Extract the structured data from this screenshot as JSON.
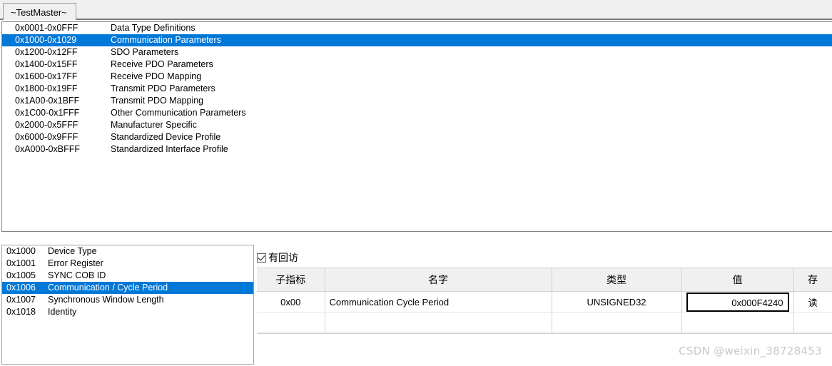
{
  "window": {
    "tab_label": "~TestMaster~"
  },
  "object_dictionary_ranges": {
    "selected_index": 1,
    "rows": [
      {
        "code": "0x0001-0x0FFF",
        "desc": "Data Type Definitions"
      },
      {
        "code": "0x1000-0x1029",
        "desc": "Communication Parameters"
      },
      {
        "code": "0x1200-0x12FF",
        "desc": "SDO Parameters"
      },
      {
        "code": "0x1400-0x15FF",
        "desc": "Receive PDO Parameters"
      },
      {
        "code": "0x1600-0x17FF",
        "desc": "Receive PDO Mapping"
      },
      {
        "code": "0x1800-0x19FF",
        "desc": "Transmit PDO Parameters"
      },
      {
        "code": "0x1A00-0x1BFF",
        "desc": "Transmit PDO Mapping"
      },
      {
        "code": "0x1C00-0x1FFF",
        "desc": "Other Communication Parameters"
      },
      {
        "code": "0x2000-0x5FFF",
        "desc": "Manufacturer Specific"
      },
      {
        "code": "0x6000-0x9FFF",
        "desc": "Standardized Device Profile"
      },
      {
        "code": "0xA000-0xBFFF",
        "desc": "Standardized Interface Profile"
      }
    ]
  },
  "index_list": {
    "selected_index": 3,
    "rows": [
      {
        "code": "0x1000",
        "name": "Device Type"
      },
      {
        "code": "0x1001",
        "name": "Error Register"
      },
      {
        "code": "0x1005",
        "name": "SYNC COB ID"
      },
      {
        "code": "0x1006",
        "name": "Communication / Cycle Period"
      },
      {
        "code": "0x1007",
        "name": "Synchronous Window Length"
      },
      {
        "code": "0x1018",
        "name": "Identity"
      }
    ]
  },
  "detail": {
    "checkbox": {
      "label": "有回访",
      "checked": true
    },
    "columns": [
      "子指标",
      "名字",
      "类型",
      "值",
      "存"
    ],
    "rows": [
      {
        "sub_index": "0x00",
        "name": "Communication Cycle Period",
        "type": "UNSIGNED32",
        "value": "0x000F4240",
        "access": "读"
      }
    ]
  },
  "watermark": {
    "text": "CSDN @weixin_38728453"
  },
  "colors": {
    "selection_blue": "#0078d7",
    "header_gray": "#f0f0f0",
    "border_gray": "#d2d2d2",
    "watermark_gray": "#c8c8c8"
  }
}
